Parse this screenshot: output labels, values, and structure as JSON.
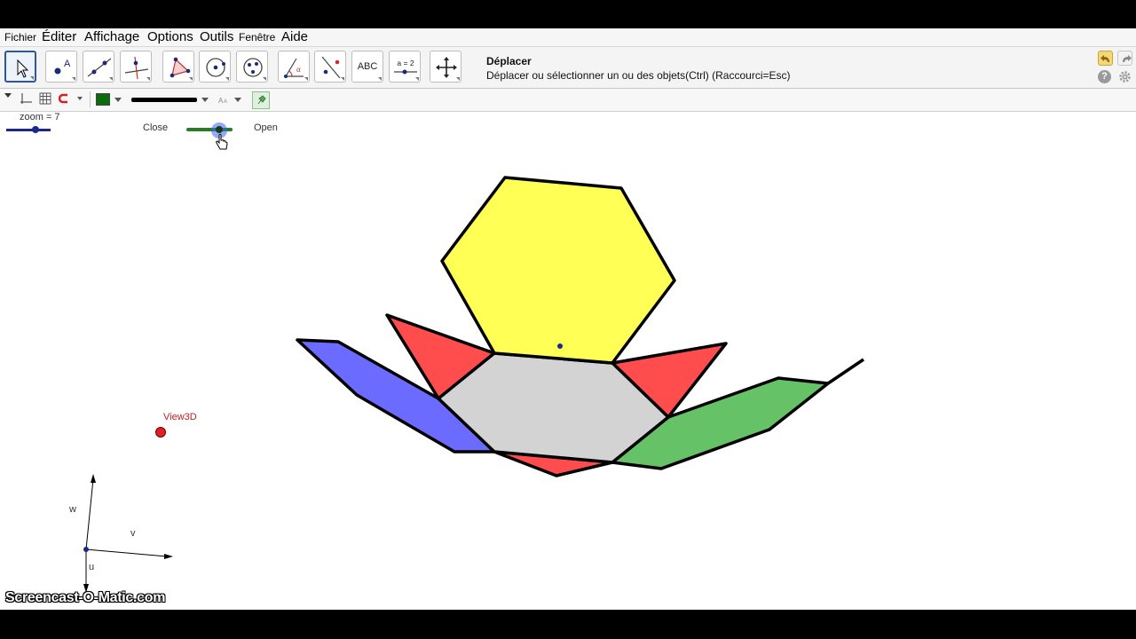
{
  "menu": {
    "items": [
      "Fichier",
      "Éditer",
      "Affichage",
      "Options",
      "Outils",
      "Fenêtre",
      "Aide"
    ]
  },
  "toolbar": {
    "tools": [
      {
        "name": "move-tool",
        "icon": "arrow-cursor-icon",
        "selected": true
      },
      {
        "name": "point-tool",
        "icon": "point-icon"
      },
      {
        "name": "line-tool",
        "icon": "line-icon"
      },
      {
        "name": "perpendicular-tool",
        "icon": "perpendicular-line-icon"
      },
      {
        "name": "polygon-tool",
        "icon": "polygon-icon"
      },
      {
        "name": "circle-tool",
        "icon": "circle-center-icon"
      },
      {
        "name": "circle-three-points-tool",
        "icon": "circle-three-points-icon"
      },
      {
        "name": "angle-tool",
        "icon": "angle-icon"
      },
      {
        "name": "reflect-tool",
        "icon": "reflect-icon"
      },
      {
        "name": "text-tool",
        "icon": "text-icon",
        "label": "ABC"
      },
      {
        "name": "slider-tool",
        "icon": "slider-icon",
        "label": "a = 2"
      },
      {
        "name": "move-view-tool",
        "icon": "move-view-icon"
      }
    ],
    "help_title": "Déplacer",
    "help_text": "Déplacer ou sélectionner un ou des objets(Ctrl) (Raccourci=Esc)"
  },
  "stylebar": {
    "color": "#0a6b0a"
  },
  "canvas": {
    "zoom_label": "zoom = 7",
    "close_label": "Close",
    "open_label": "Open",
    "view3d_label": "View3D",
    "axis_w": "w",
    "axis_v": "v",
    "axis_u": "u",
    "colors": {
      "hexagon_top": "#ffff55",
      "hexagon_center": "#d3d3d3",
      "triangles": "#ff4d4d",
      "left_face": "#6b6bff",
      "right_face": "#66c266",
      "view3d_point": "#e02020"
    }
  },
  "watermark": "Screencast-O-Matic.com"
}
